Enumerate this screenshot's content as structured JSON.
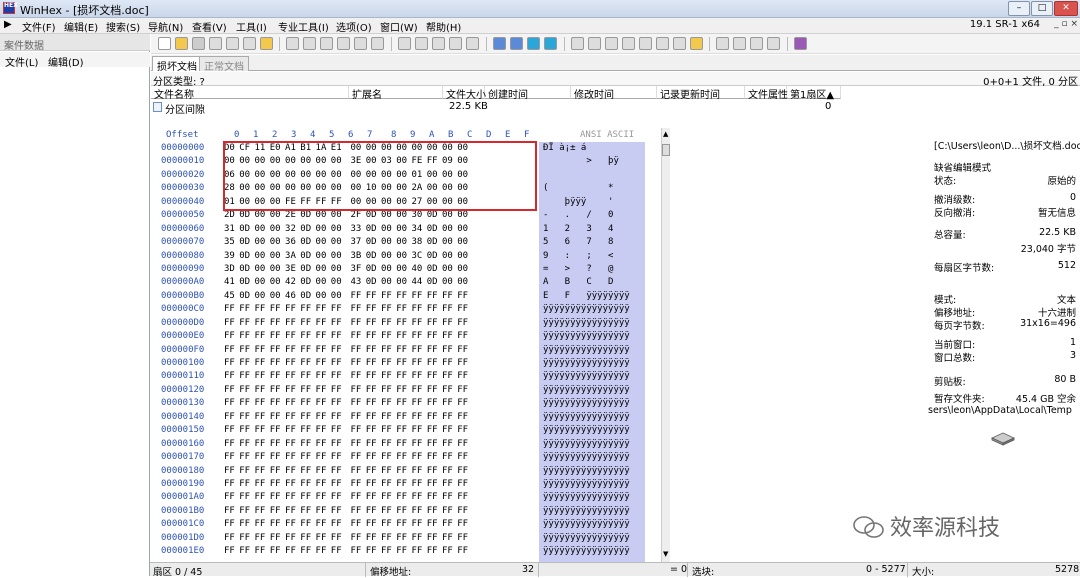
{
  "window": {
    "title": "WinHex - [损坏文档.doc]",
    "version": "19.1 SR-1 x64"
  },
  "menu": [
    "文件(F)",
    "编辑(E)",
    "搜索(S)",
    "导航(N)",
    "查看(V)",
    "工具(I)",
    "专业工具(I)",
    "选项(O)",
    "窗口(W)",
    "帮助(H)"
  ],
  "left_pane": {
    "title": "案件数据",
    "menu_file": "文件(L)",
    "menu_edit": "编辑(D)"
  },
  "tabs": [
    "损坏文档",
    "正常文档"
  ],
  "partition": {
    "type_label": "分区类型: ?",
    "summary": "0+0+1 文件, 0 分区"
  },
  "file_list": {
    "columns": [
      "文件名称",
      "扩展名",
      "文件大小",
      "创建时间",
      "修改时间",
      "记录更新时间",
      "文件属性",
      "第1扇区▲"
    ],
    "row": {
      "name": "分区间隙",
      "size": "22.5 KB",
      "first_sector": "0"
    }
  },
  "hex_header": {
    "offset": "Offset",
    "cols": [
      "0",
      "1",
      "2",
      "3",
      "4",
      "5",
      "6",
      "7",
      "8",
      "9",
      "A",
      "B",
      "C",
      "D",
      "E",
      "F"
    ],
    "ascii": "ANSI ASCII"
  },
  "offsets": [
    "00000000",
    "00000010",
    "00000020",
    "00000030",
    "00000040",
    "00000050",
    "00000060",
    "00000070",
    "00000080",
    "00000090",
    "000000A0",
    "000000B0",
    "000000C0",
    "000000D0",
    "000000E0",
    "000000F0",
    "00000100",
    "00000110",
    "00000120",
    "00000130",
    "00000140",
    "00000150",
    "00000160",
    "00000170",
    "00000180",
    "00000190",
    "000001A0",
    "000001B0",
    "000001C0",
    "000001D0",
    "000001E0"
  ],
  "hex_rows": [
    "D0 CF 11 E0 A1 B1 1A E1  00 00 00 00 00 00 00 00",
    "00 00 00 00 00 00 00 00  3E 00 03 00 FE FF 09 00",
    "06 00 00 00 00 00 00 00  00 00 00 00 01 00 00 00",
    "28 00 00 00 00 00 00 00  00 10 00 00 2A 00 00 00",
    "01 00 00 00 FE FF FF FF  00 00 00 00 27 00 00 00",
    "2D 0D 00 00 2E 0D 00 00  2F 0D 00 00 30 0D 00 00",
    "31 0D 00 00 32 0D 00 00  33 0D 00 00 34 0D 00 00",
    "35 0D 00 00 36 0D 00 00  37 0D 00 00 38 0D 00 00",
    "39 0D 00 00 3A 0D 00 00  3B 0D 00 00 3C 0D 00 00",
    "3D 0D 00 00 3E 0D 00 00  3F 0D 00 00 40 0D 00 00",
    "41 0D 00 00 42 0D 00 00  43 0D 00 00 44 0D 00 00",
    "45 0D 00 00 46 0D 00 00  FF FF FF FF FF FF FF FF",
    "FF FF FF FF FF FF FF FF  FF FF FF FF FF FF FF FF",
    "FF FF FF FF FF FF FF FF  FF FF FF FF FF FF FF FF",
    "FF FF FF FF FF FF FF FF  FF FF FF FF FF FF FF FF",
    "FF FF FF FF FF FF FF FF  FF FF FF FF FF FF FF FF",
    "FF FF FF FF FF FF FF FF  FF FF FF FF FF FF FF FF",
    "FF FF FF FF FF FF FF FF  FF FF FF FF FF FF FF FF",
    "FF FF FF FF FF FF FF FF  FF FF FF FF FF FF FF FF",
    "FF FF FF FF FF FF FF FF  FF FF FF FF FF FF FF FF",
    "FF FF FF FF FF FF FF FF  FF FF FF FF FF FF FF FF",
    "FF FF FF FF FF FF FF FF  FF FF FF FF FF FF FF FF",
    "FF FF FF FF FF FF FF FF  FF FF FF FF FF FF FF FF",
    "FF FF FF FF FF FF FF FF  FF FF FF FF FF FF FF FF",
    "FF FF FF FF FF FF FF FF  FF FF FF FF FF FF FF FF",
    "FF FF FF FF FF FF FF FF  FF FF FF FF FF FF FF FF",
    "FF FF FF FF FF FF FF FF  FF FF FF FF FF FF FF FF",
    "FF FF FF FF FF FF FF FF  FF FF FF FF FF FF FF FF",
    "FF FF FF FF FF FF FF FF  FF FF FF FF FF FF FF FF",
    "FF FF FF FF FF FF FF FF  FF FF FF FF FF FF FF FF",
    "FF FF FF FF FF FF FF FF  FF FF FF FF FF FF FF FF"
  ],
  "ascii_rows": [
    "ÐÏ à¡± á",
    "        >   þÿ",
    "",
    "(           *",
    "    þÿÿÿ    '",
    "-   .   /   0",
    "1   2   3   4",
    "5   6   7   8",
    "9   :   ;   <",
    "=   >   ?   @",
    "A   B   C   D",
    "E   F   ÿÿÿÿÿÿÿÿ",
    "ÿÿÿÿÿÿÿÿÿÿÿÿÿÿÿÿ",
    "ÿÿÿÿÿÿÿÿÿÿÿÿÿÿÿÿ",
    "ÿÿÿÿÿÿÿÿÿÿÿÿÿÿÿÿ",
    "ÿÿÿÿÿÿÿÿÿÿÿÿÿÿÿÿ",
    "ÿÿÿÿÿÿÿÿÿÿÿÿÿÿÿÿ",
    "ÿÿÿÿÿÿÿÿÿÿÿÿÿÿÿÿ",
    "ÿÿÿÿÿÿÿÿÿÿÿÿÿÿÿÿ",
    "ÿÿÿÿÿÿÿÿÿÿÿÿÿÿÿÿ",
    "ÿÿÿÿÿÿÿÿÿÿÿÿÿÿÿÿ",
    "ÿÿÿÿÿÿÿÿÿÿÿÿÿÿÿÿ",
    "ÿÿÿÿÿÿÿÿÿÿÿÿÿÿÿÿ",
    "ÿÿÿÿÿÿÿÿÿÿÿÿÿÿÿÿ",
    "ÿÿÿÿÿÿÿÿÿÿÿÿÿÿÿÿ",
    "ÿÿÿÿÿÿÿÿÿÿÿÿÿÿÿÿ",
    "ÿÿÿÿÿÿÿÿÿÿÿÿÿÿÿÿ",
    "ÿÿÿÿÿÿÿÿÿÿÿÿÿÿÿÿ",
    "ÿÿÿÿÿÿÿÿÿÿÿÿÿÿÿÿ",
    "ÿÿÿÿÿÿÿÿÿÿÿÿÿÿÿÿ",
    "ÿÿÿÿÿÿÿÿÿÿÿÿÿÿÿÿ"
  ],
  "info": {
    "path": "[C:\\Users\\leon\\D...\\损坏文档.doc]",
    "edit_mode_label": "缺省编辑模式",
    "state_label": "状态:",
    "state_val": "原始的",
    "undo_label": "撤消级数:",
    "undo_val": "0",
    "reverse_label": "反向撤消:",
    "reverse_val": "暂无信息",
    "total_label": "总容量:",
    "total_val": "22.5 KB",
    "total_bytes": "23,040 字节",
    "sector_label": "每扇区字节数:",
    "sector_val": "512",
    "mode_label": "模式:",
    "mode_val": "文本",
    "offset_label": "偏移地址:",
    "offset_val": "十六进制",
    "page_label": "每页字节数:",
    "page_val": "31x16=496",
    "curwin_label": "当前窗口:",
    "curwin_val": "1",
    "wincount_label": "窗口总数:",
    "wincount_val": "3",
    "clip_label": "剪贴板:",
    "clip_val": "80 B",
    "temp_label": "暂存文件夹:",
    "temp_val": "45.4 GB 空余",
    "temp_path": "sers\\leon\\AppData\\Local\\Temp"
  },
  "status": {
    "sector": "扇区 0 / 45",
    "offset_label": "偏移地址:",
    "offset_val": "32",
    "eq": "= 0",
    "select_label": "选块:",
    "select_val": "0 - 5277",
    "size_label": "大小:",
    "size_val": "5278"
  },
  "watermark": "效率源科技"
}
